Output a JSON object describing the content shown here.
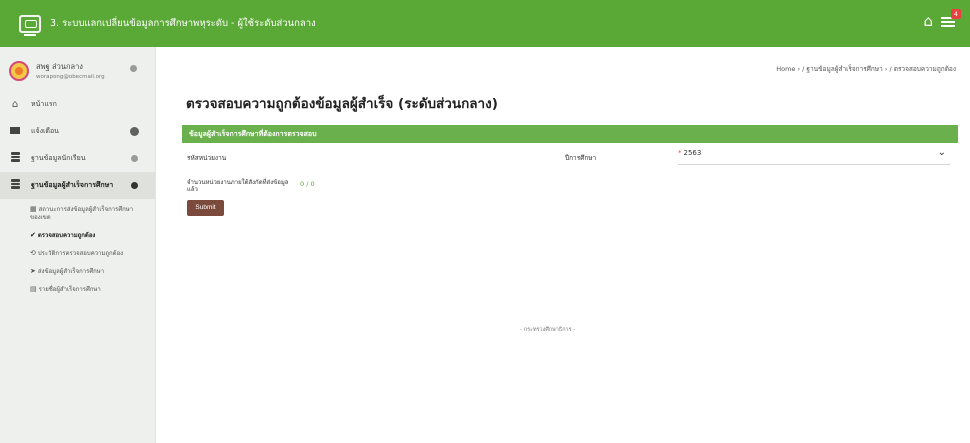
{
  "header": {
    "app_title": "3. ระบบแลกเปลี่ยนข้อมูลการศึกษาพหุระดับ - ผู้ใช้ระดับส่วนกลาง",
    "notification_count": "4",
    "icons": [
      "logo-icon",
      "home-icon",
      "notification-icon"
    ],
    "accent_color": "#5aa835"
  },
  "profile": {
    "name": "สพฐ ส่วนกลาง",
    "email": "worapong@obecmail.org"
  },
  "sidebar": {
    "items": [
      {
        "label": "หน้าแรก",
        "icon": "home-icon"
      },
      {
        "label": "แจ้งเตือน",
        "icon": "mail-icon"
      },
      {
        "label": "ฐานข้อมูลนักเรียน",
        "icon": "database-icon"
      },
      {
        "label": "ฐานข้อมูลผู้สำเร็จการศึกษา",
        "icon": "database-icon"
      }
    ],
    "sub_items": [
      {
        "label": "สถานะการส่งข้อมูลผู้สำเร็จการศึกษาของเขต",
        "icon": "grid-icon"
      },
      {
        "label": "ตรวจสอบความถูกต้อง",
        "icon": "check-icon"
      },
      {
        "label": "ประวัติการตรวจสอบความถูกต้อง",
        "icon": "history-icon"
      },
      {
        "label": "ส่งข้อมูลผู้สำเร็จการศึกษา",
        "icon": "send-icon"
      },
      {
        "label": "รายชื่อผู้สำเร็จการศึกษา",
        "icon": "list-icon"
      }
    ]
  },
  "breadcrumb": "Home › / ฐานข้อมูลผู้สำเร็จการศึกษา › / ตรวจสอบความถูกต้อง",
  "page_title": "ตรวจสอบความถูกต้องข้อมูลผู้สำเร็จ (ระดับส่วนกลาง)",
  "panel": {
    "header": "ข้อมูลผู้สำเร็จการศึกษาที่ต้องการตรวจสอบ",
    "unit_code_label": "รหัสหน่วยงาน",
    "academic_year_label": "ปีการศึกษา",
    "academic_year_value": "2563",
    "required_mark": "*",
    "count_label": "จำนวนหน่วยงานภายใต้สังกัดที่ส่งข้อมูลแล้ว",
    "count_value": "0 / 0",
    "submit_label": "Submit"
  },
  "footer": "- กระทรวงศึกษาธิการ -"
}
